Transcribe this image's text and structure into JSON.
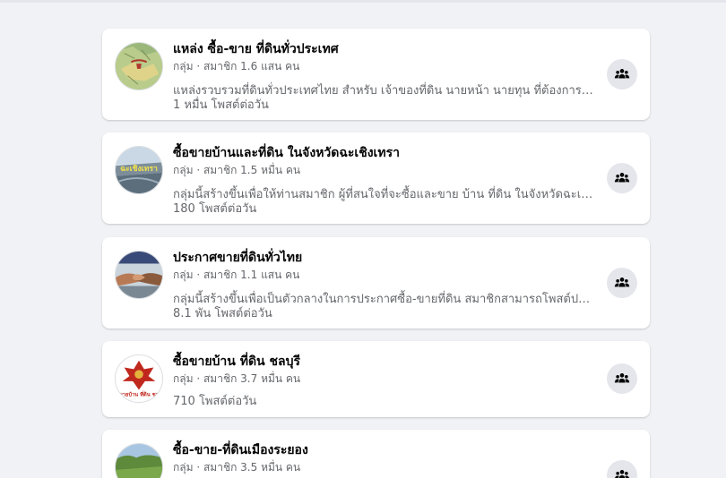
{
  "groups": [
    {
      "name": "แหล่ง ซื้อ-ขาย ที่ดินทั่วประเทศ",
      "meta": "กลุ่ม · สมาชิก 1.6 แสน คน",
      "description": "แหล่งรวบรวมที่ดินทั่วประเทศไทย สำหรับ เจ้าของที่ดิน นายหน้า นายทุน ที่ต้องการหา...",
      "posts": "1 หมื่น โพสต์ต่อวัน",
      "icon": "group-join-icon"
    },
    {
      "name": "ซื้อขายบ้านและที่ดิน ในจังหวัดฉะเชิงเทรา",
      "meta": "กลุ่ม · สมาชิก 1.5 หมื่น คน",
      "description": "กลุ่มนี้สร้างขึ้นเพื่อให้ท่านสมาชิก ผู้ที่สนใจที่จะซื้อและขาย บ้าน ที่ดิน ในจังหวัดฉะเชิง...",
      "posts": "180 โพสต์ต่อวัน",
      "avatar_text": "ฉะเชิงเทรา",
      "icon": "group-join-icon"
    },
    {
      "name": "ประกาศขายที่ดินทั่วไทย",
      "meta": "กลุ่ม · สมาชิก 1.1 แสน คน",
      "description": "กลุ่มนี้สร้างขึ้นเพื่อเป็นตัวกลางในการประกาศซื้อ-ขายที่ดิน สมาชิกสามารถโพสต์ประก...",
      "posts": "8.1 พัน โพสต์ต่อวัน",
      "icon": "group-join-icon"
    },
    {
      "name": "ซื้อขายบ้าน ที่ดิน ชลบุรี",
      "meta": "กลุ่ม · สมาชิก 3.7 หมื่น คน",
      "description": "",
      "posts": "710 โพสต์ต่อวัน",
      "avatar_text": "ขายบ้าน ที่ดิน ชล",
      "icon": "group-join-icon"
    },
    {
      "name": "ซื้อ-ขาย-ที่ดินเมืองระยอง",
      "meta": "กลุ่ม · สมาชิก 3.5 หมื่น คน",
      "description": "",
      "posts": "",
      "icon": "group-join-icon"
    }
  ]
}
